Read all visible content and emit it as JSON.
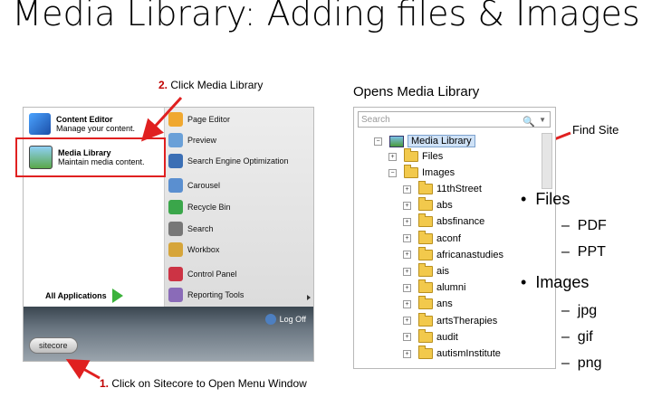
{
  "title": "Media Library: Adding files & Images",
  "step2_caption": {
    "num": "2.",
    "text": "Click Media Library"
  },
  "opens_caption": "Opens Media Library",
  "step1_caption": {
    "num": "1.",
    "text": "Click on Sitecore to Open Menu Window"
  },
  "find_site": "Find Site",
  "menu": {
    "content_editor": {
      "title": "Content Editor",
      "sub": "Manage your content."
    },
    "media_library": {
      "title": "Media Library",
      "sub": "Maintain media content."
    },
    "all_applications": "All Applications",
    "right_items": [
      "Page Editor",
      "Preview",
      "Search Engine Optimization",
      "Carousel",
      "Recycle Bin",
      "Search",
      "Workbox",
      "Control Panel",
      "Reporting Tools"
    ],
    "logoff": "Log Off",
    "sitecore": "sitecore"
  },
  "tree": {
    "search_placeholder": "Search",
    "root": "Media Library",
    "files": "Files",
    "images": "Images",
    "children": [
      "11thStreet",
      "abs",
      "absfinance",
      "aconf",
      "africanastudies",
      "ais",
      "alumni",
      "ans",
      "artsTherapies",
      "audit",
      "autismInstitute"
    ]
  },
  "bullets": {
    "files": "Files",
    "files_items": [
      "PDF",
      "PPT"
    ],
    "images": "Images",
    "images_items": [
      "jpg",
      "gif",
      "png"
    ]
  },
  "colors": {
    "highlight": "#e02020",
    "arrow": "#e02020"
  }
}
